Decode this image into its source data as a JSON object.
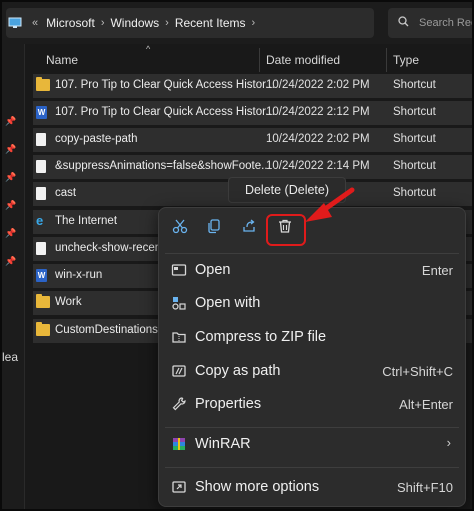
{
  "breadcrumb": [
    "Microsoft",
    "Windows",
    "Recent Items"
  ],
  "search": {
    "placeholder": "Search Rec"
  },
  "left_text": "lea",
  "columns": {
    "name": "Name",
    "date": "Date modified",
    "type": "Type"
  },
  "rows": [
    {
      "icon": "folder-icon",
      "name": "107. Pro Tip to Clear Quick Access Histor...",
      "date": "10/24/2022 2:02 PM",
      "type": "Shortcut"
    },
    {
      "icon": "word-doc-icon",
      "name": "107. Pro Tip to Clear Quick Access Histor...",
      "date": "10/24/2022 2:12 PM",
      "type": "Shortcut"
    },
    {
      "icon": "file-icon",
      "name": "copy-paste-path",
      "date": "10/24/2022 2:02 PM",
      "type": "Shortcut"
    },
    {
      "icon": "file-icon",
      "name": "&suppressAnimations=false&showFoote...",
      "date": "10/24/2022 2:14 PM",
      "type": "Shortcut"
    },
    {
      "icon": "file-icon",
      "name": "cast",
      "date": "",
      "type": "Shortcut"
    },
    {
      "icon": "internet-explorer-icon",
      "name": "The Internet",
      "date": "",
      "type": ""
    },
    {
      "icon": "file-icon",
      "name": "uncheck-show-recent",
      "date": "",
      "type": ""
    },
    {
      "icon": "word-doc-icon",
      "name": "win-x-run",
      "date": "",
      "type": ""
    },
    {
      "icon": "folder-icon",
      "name": "Work",
      "date": "",
      "type": ""
    },
    {
      "icon": "folder-icon",
      "name": "CustomDestinations",
      "date": "",
      "type": ""
    }
  ],
  "tooltip": "Delete (Delete)",
  "menu": {
    "items": [
      {
        "icon": "open-icon",
        "label": "Open",
        "shortcut": "Enter"
      },
      {
        "icon": "open-with-icon",
        "label": "Open with",
        "shortcut": ""
      },
      {
        "icon": "zip-icon",
        "label": "Compress to ZIP file",
        "shortcut": ""
      },
      {
        "icon": "copy-path-icon",
        "label": "Copy as path",
        "shortcut": "Ctrl+Shift+C"
      },
      {
        "icon": "properties-icon",
        "label": "Properties",
        "shortcut": "Alt+Enter"
      },
      {
        "icon": "winrar-icon",
        "label": "WinRAR",
        "shortcut": ""
      },
      {
        "icon": "show-more-icon",
        "label": "Show more options",
        "shortcut": "Shift+F10"
      }
    ],
    "submenu_glyph": "›"
  },
  "colors": {
    "accent": "#6ab4f0",
    "highlight": "#e01b1b"
  }
}
